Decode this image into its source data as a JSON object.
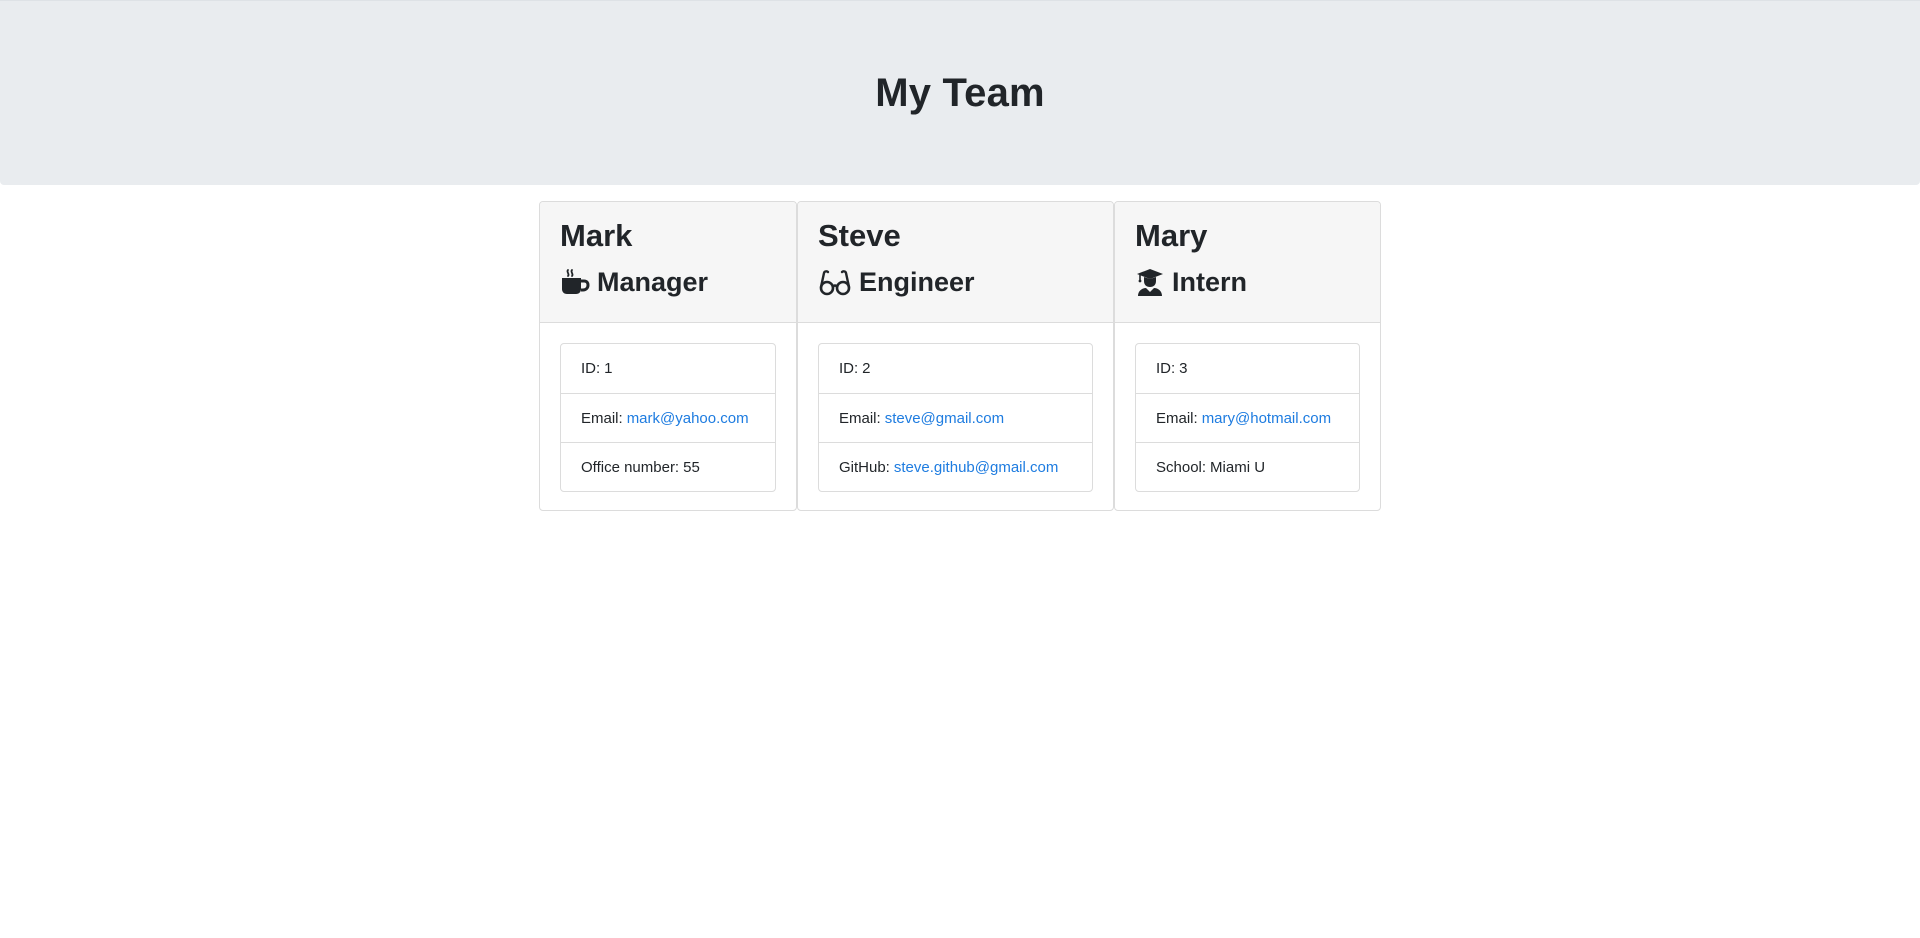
{
  "header": {
    "title": "My Team"
  },
  "team": {
    "manager": {
      "name": "Mark",
      "role": "Manager",
      "icon": "coffee-mug-icon",
      "id_label": "ID:",
      "id": "1",
      "email_label": "Email:",
      "email": "mark@yahoo.com",
      "extra_label": "Office number:",
      "extra": "55"
    },
    "engineer": {
      "name": "Steve",
      "role": "Engineer",
      "icon": "glasses-icon",
      "id_label": "ID:",
      "id": "2",
      "email_label": "Email:",
      "email": "steve@gmail.com",
      "extra_label": "GitHub:",
      "extra": "steve.github@gmail.com"
    },
    "intern": {
      "name": "Mary",
      "role": "Intern",
      "icon": "graduate-icon",
      "id_label": "ID:",
      "id": "3",
      "email_label": "Email:",
      "email": "mary@hotmail.com",
      "extra_label": "School:",
      "extra": "Miami U"
    }
  },
  "colors": {
    "jumbotron_bg": "#e9ecef",
    "card_header_bg": "#f6f6f6",
    "link": "#1e7ce0",
    "text": "#212529"
  }
}
